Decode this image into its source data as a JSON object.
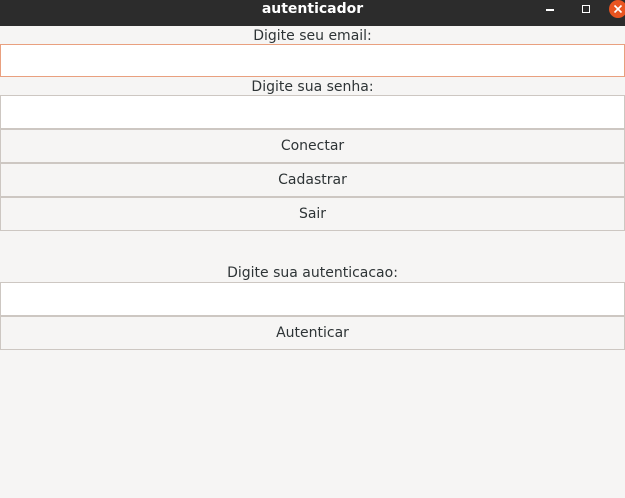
{
  "window": {
    "title": "autenticador"
  },
  "form": {
    "email_label": "Digite seu email:",
    "email_value": "",
    "password_label": "Digite sua senha:",
    "password_value": "",
    "connect_label": "Conectar",
    "register_label": "Cadastrar",
    "exit_label": "Sair",
    "auth_label": "Digite sua autenticacao:",
    "auth_value": "",
    "authenticate_label": "Autenticar"
  },
  "colors": {
    "titlebar": "#2c2c2c",
    "close_button": "#e95420",
    "window_bg": "#f6f5f4",
    "focus_border": "#e9a07f"
  },
  "icons": {
    "minimize": "minimize-icon",
    "maximize": "maximize-icon",
    "close": "close-icon"
  }
}
